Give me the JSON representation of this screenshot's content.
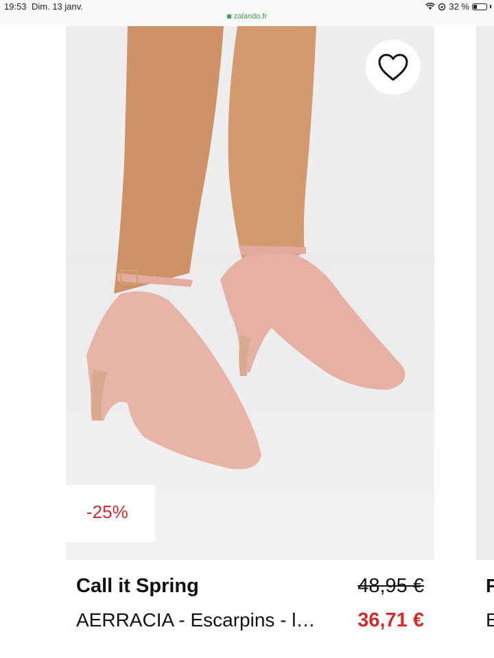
{
  "status_bar": {
    "time": "19:53",
    "date": "Dim. 13 janv.",
    "url": "zalando.fr",
    "battery": "32 %",
    "battery_level": 0.32
  },
  "product": {
    "brand": "Call it Spring",
    "name": "AERRACIA - Escarpins - l…",
    "old_price": "48,95 €",
    "new_price": "36,71 €",
    "discount": "-25%",
    "image": "pink-suede-pumps-photo"
  },
  "colors": {
    "accent": "#d32b2b",
    "url_green": "#3aa24a",
    "shoe_pink": "#e8b3a8",
    "skin": "#d69a70"
  }
}
